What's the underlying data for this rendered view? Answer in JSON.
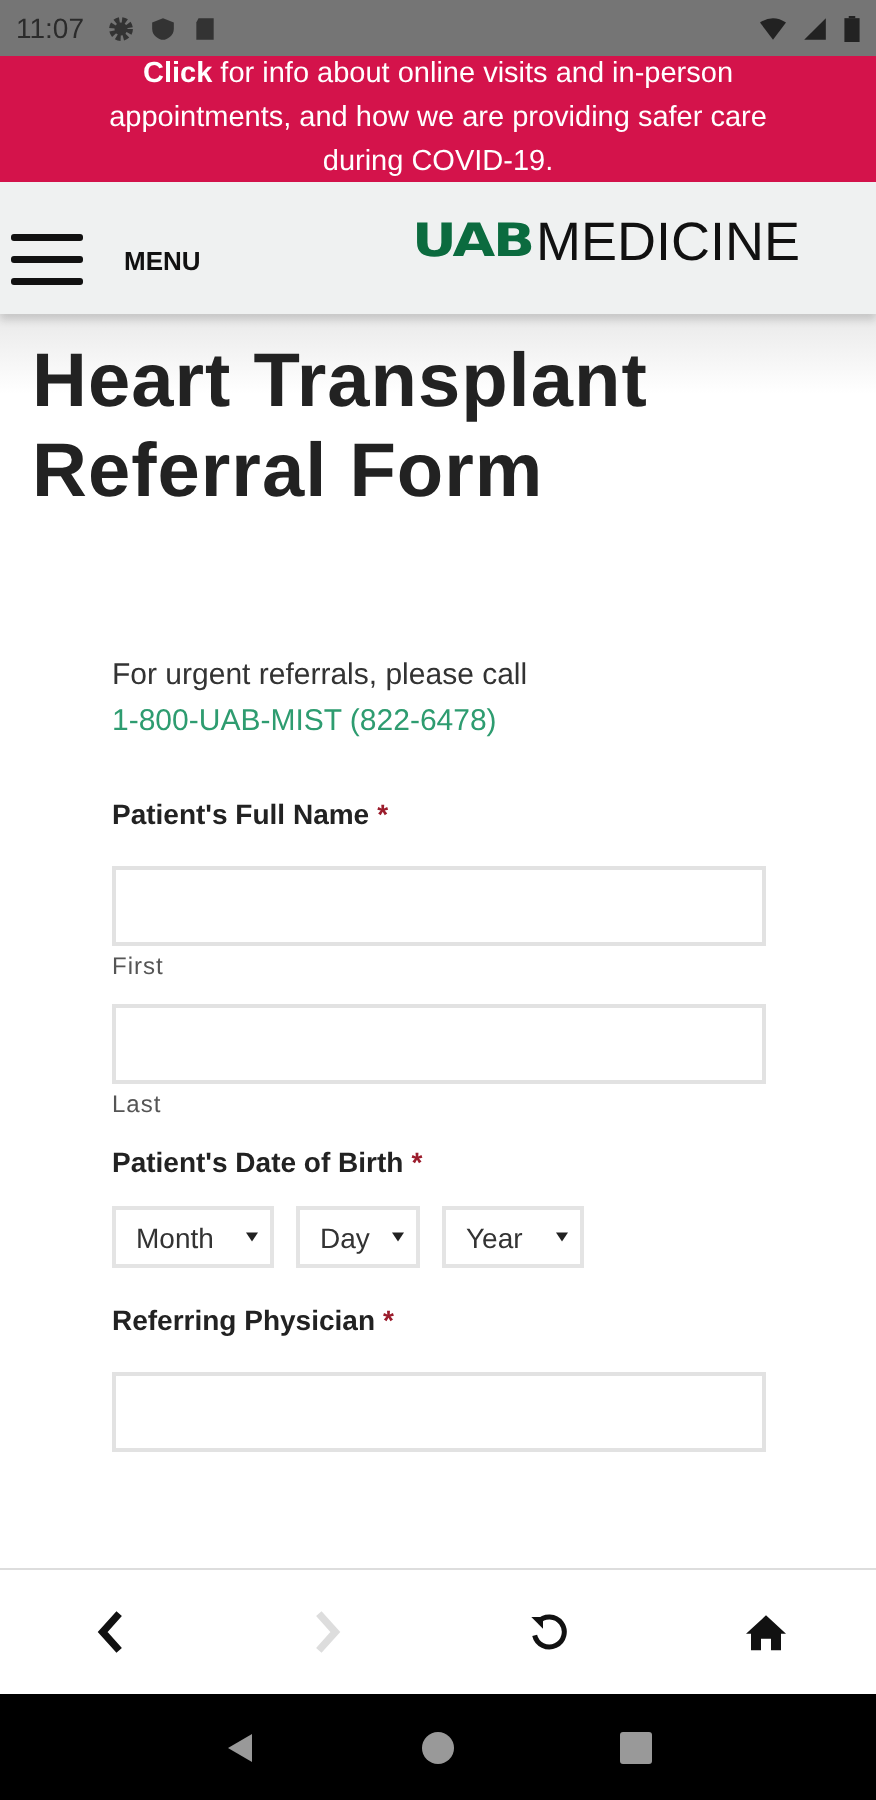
{
  "status_bar": {
    "time": "11:07"
  },
  "banner": {
    "text": "**Click** for info about online visits and in-person appointments, and how we are providing safer care during COVID-19."
  },
  "header": {
    "menu_label": "MENU",
    "logo_mark": "UAB",
    "logo_text": "MEDICINE"
  },
  "page_title": "Heart Transplant Referral Form",
  "urgent": {
    "text": "For urgent referrals, please call",
    "phone": "1-800-UAB-MIST (822-6478)"
  },
  "fields": [
    {
      "kind": "name",
      "label": "Patient's Full Name",
      "required_mark": "*",
      "inputs": [
        {
          "sublabel": "First"
        },
        {
          "sublabel": "Last"
        }
      ]
    },
    {
      "kind": "date",
      "label": "Patient's Date of Birth",
      "required_mark": "*",
      "selects": [
        {
          "value": "Month"
        },
        {
          "value": "Day"
        },
        {
          "value": "Year"
        }
      ]
    },
    {
      "kind": "single",
      "label": "Referring Physician",
      "required_mark": "*"
    }
  ],
  "browser_nav": {
    "forward_disabled": true
  }
}
